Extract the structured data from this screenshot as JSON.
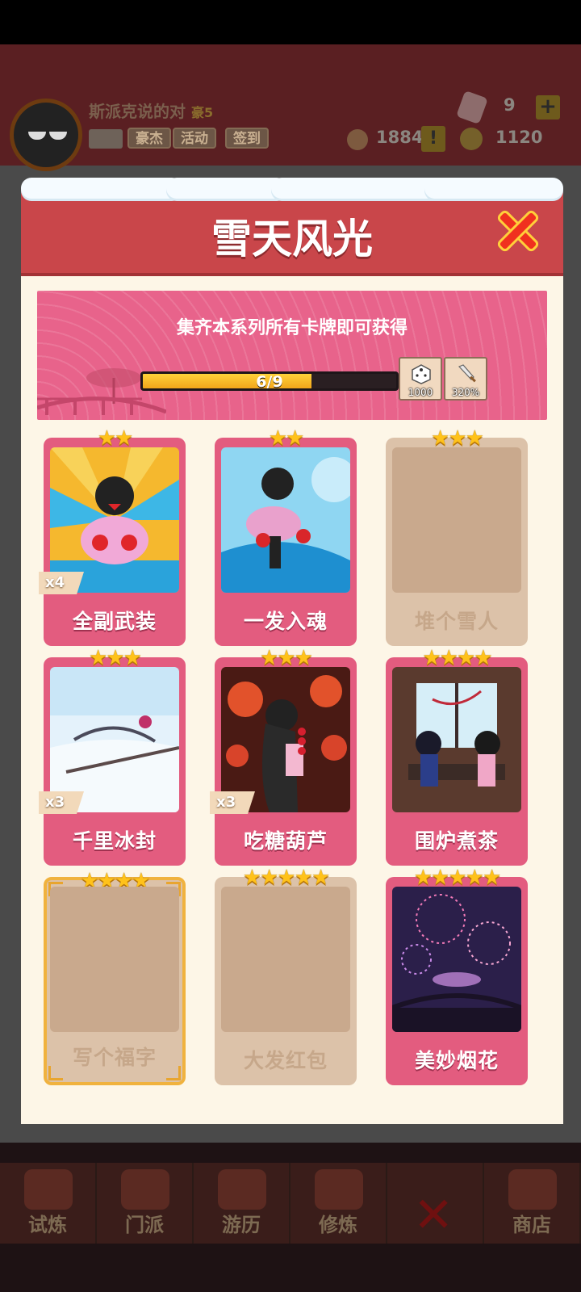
{
  "player": {
    "name": "斯派克说的对",
    "rank": "豪5"
  },
  "header_buttons": [
    "豪杰",
    "活动",
    "签到"
  ],
  "resources": {
    "crystal": "9",
    "tickets": "1884",
    "coins": "1120"
  },
  "icons": {
    "add": "+",
    "alert": "!"
  },
  "nav": [
    "试炼",
    "门派",
    "游历",
    "修炼",
    "",
    "商店"
  ],
  "modal": {
    "title": "雪天风光",
    "banner_text": "集齐本系列所有卡牌即可获得",
    "progress": {
      "label": "6/9",
      "collected": 6,
      "total": 9
    },
    "rewards": [
      {
        "icon": "dice-icon",
        "value": "1000"
      },
      {
        "icon": "sword-icon",
        "value": "320%"
      }
    ]
  },
  "cards": [
    {
      "name": "全副武装",
      "stars": "★★",
      "owned": true,
      "count": "x4"
    },
    {
      "name": "一发入魂",
      "stars": "★★",
      "owned": true,
      "count": ""
    },
    {
      "name": "堆个雪人",
      "stars": "★★★",
      "owned": false,
      "count": ""
    },
    {
      "name": "千里冰封",
      "stars": "★★★",
      "owned": true,
      "count": "x3"
    },
    {
      "name": "吃糖葫芦",
      "stars": "★★★",
      "owned": true,
      "count": "x3"
    },
    {
      "name": "围炉煮茶",
      "stars": "★★★★",
      "owned": true,
      "count": ""
    },
    {
      "name": "写个福字",
      "stars": "★★★★",
      "owned": false,
      "count": ""
    },
    {
      "name": "大发红包",
      "stars": "★★★★★",
      "owned": false,
      "count": ""
    },
    {
      "name": "美妙烟花",
      "stars": "★★★★★",
      "owned": true,
      "count": ""
    }
  ],
  "colors": {
    "header": "#c9464a",
    "card_owned": "#e35c7f",
    "card_locked": "#dcc2a9",
    "star": "#ffc21a",
    "progress": "#f2a51a"
  }
}
